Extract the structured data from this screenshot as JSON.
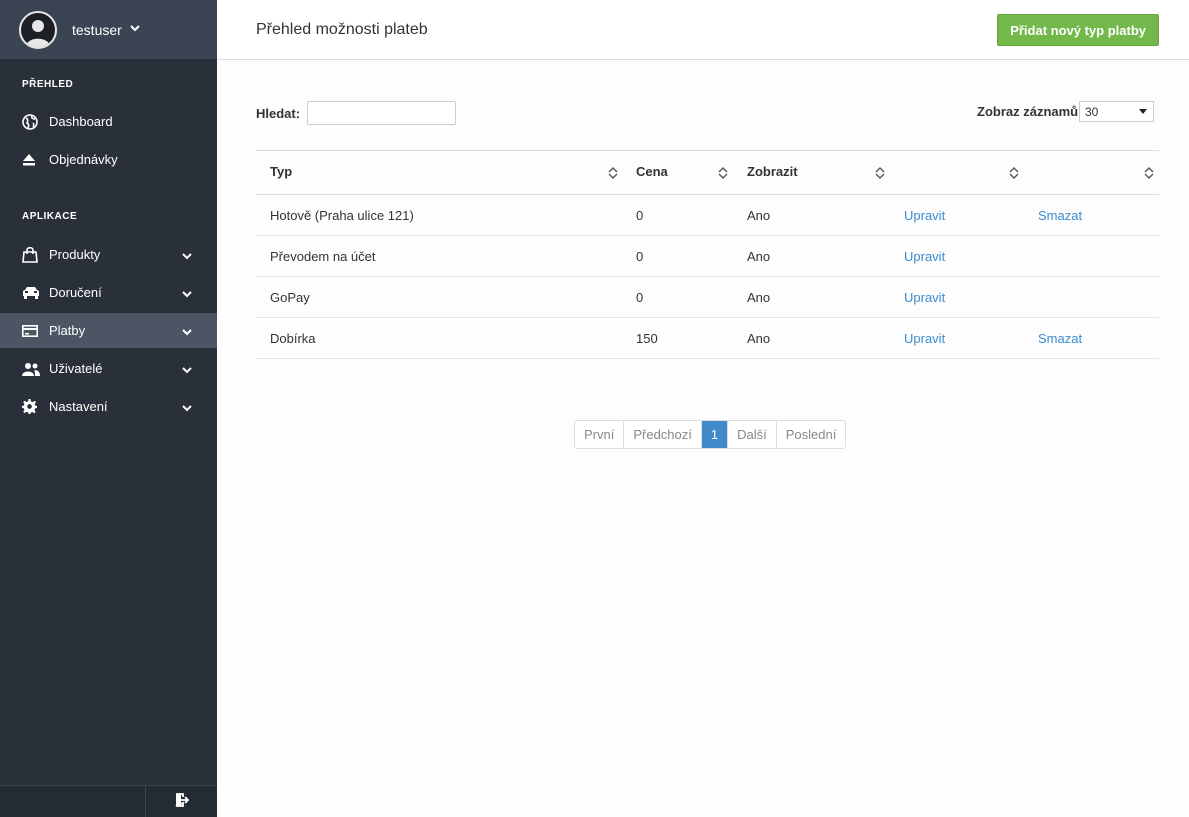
{
  "sidebar": {
    "user_name": "testuser",
    "section_overview": "PŘEHLED",
    "section_apps": "APLIKACE",
    "items": [
      {
        "label": "Dashboard",
        "icon": "globe-icon"
      },
      {
        "label": "Objednávky",
        "icon": "eject-icon"
      },
      {
        "label": "Produkty",
        "icon": "shopping-bag-icon"
      },
      {
        "label": "Doručení",
        "icon": "car-icon"
      },
      {
        "label": "Platby",
        "icon": "credit-card-icon",
        "active": true
      },
      {
        "label": "Uživatelé",
        "icon": "users-icon"
      },
      {
        "label": "Nastavení",
        "icon": "gear-icon"
      }
    ]
  },
  "header": {
    "title": "Přehled možnosti plateb",
    "add_button": "Přidat nový typ platby"
  },
  "controls": {
    "search_label": "Hledat:",
    "search_value": "",
    "pagesize_label": "Zobraz záznamů",
    "pagesize_value": "30"
  },
  "table": {
    "columns": [
      "Typ",
      "Cena",
      "Zobrazit",
      "",
      ""
    ],
    "rows": [
      {
        "typ": "Hotově (Praha ulice 121)",
        "cena": "0",
        "zobrazit": "Ano",
        "edit": "Upravit",
        "delete": "Smazat"
      },
      {
        "typ": "Převodem na účet",
        "cena": "0",
        "zobrazit": "Ano",
        "edit": "Upravit",
        "delete": ""
      },
      {
        "typ": "GoPay",
        "cena": "0",
        "zobrazit": "Ano",
        "edit": "Upravit",
        "delete": ""
      },
      {
        "typ": "Dobírka",
        "cena": "150",
        "zobrazit": "Ano",
        "edit": "Upravit",
        "delete": "Smazat"
      }
    ]
  },
  "pagination": {
    "first": "První",
    "prev": "Předchozí",
    "current": "1",
    "next": "Další",
    "last": "Poslední"
  },
  "colors": {
    "sidebar_bg": "#2a3039",
    "accent_green": "#72b84a",
    "link_blue": "#3b8bd0",
    "page_active": "#428bca"
  }
}
